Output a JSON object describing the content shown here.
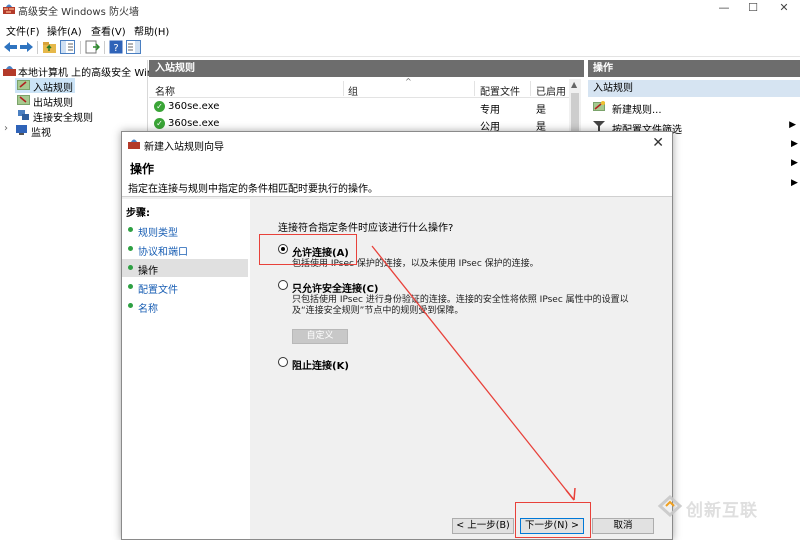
{
  "window": {
    "title": "高级安全 Windows 防火墙",
    "min_glyph": "—",
    "max_glyph": "☐",
    "close_glyph": "✕"
  },
  "menubar": [
    "文件(F)",
    "操作(A)",
    "查看(V)",
    "帮助(H)"
  ],
  "tree": {
    "root": "本地计算机 上的高级安全 Win",
    "items": [
      "入站规则",
      "出站规则",
      "连接安全规则",
      "监视"
    ]
  },
  "list": {
    "header": "入站规则",
    "columns": [
      "名称",
      "组",
      "配置文件",
      "已启用"
    ],
    "rows": [
      {
        "name": "360se.exe",
        "group": "",
        "profile": "专用",
        "enabled": "是"
      },
      {
        "name": "360se.exe",
        "group": "",
        "profile": "公用",
        "enabled": "是"
      }
    ]
  },
  "actions": {
    "header": "操作",
    "section": "入站规则",
    "items": [
      "新建规则...",
      "按配置文件筛选"
    ]
  },
  "wizard": {
    "title": "新建入站规则向导",
    "heading": "操作",
    "description": "指定在连接与规则中指定的条件相匹配时要执行的操作。",
    "steps_header": "步骤:",
    "steps": [
      "规则类型",
      "协议和端口",
      "操作",
      "配置文件",
      "名称"
    ],
    "current_step": 2,
    "question": "连接符合指定条件时应该进行什么操作?",
    "options": [
      {
        "label": "允许连接(A)",
        "desc": "包括使用 IPsec 保护的连接，以及未使用 IPsec 保护的连接。",
        "selected": true
      },
      {
        "label": "只允许安全连接(C)",
        "desc": "只包括使用 IPsec 进行身份验证的连接。连接的安全性将依照 IPsec 属性中的设置以及“连接安全规则”节点中的规则受到保障。",
        "selected": false
      },
      {
        "label": "阻止连接(K)",
        "desc": "",
        "selected": false
      }
    ],
    "customize_label": "自定义",
    "buttons": {
      "back": "< 上一步(B)",
      "next": "下一步(N) >",
      "cancel": "取消"
    }
  },
  "watermark": "创新互联",
  "colors": {
    "annotation": "#e8413a",
    "accent": "#0078d7"
  }
}
